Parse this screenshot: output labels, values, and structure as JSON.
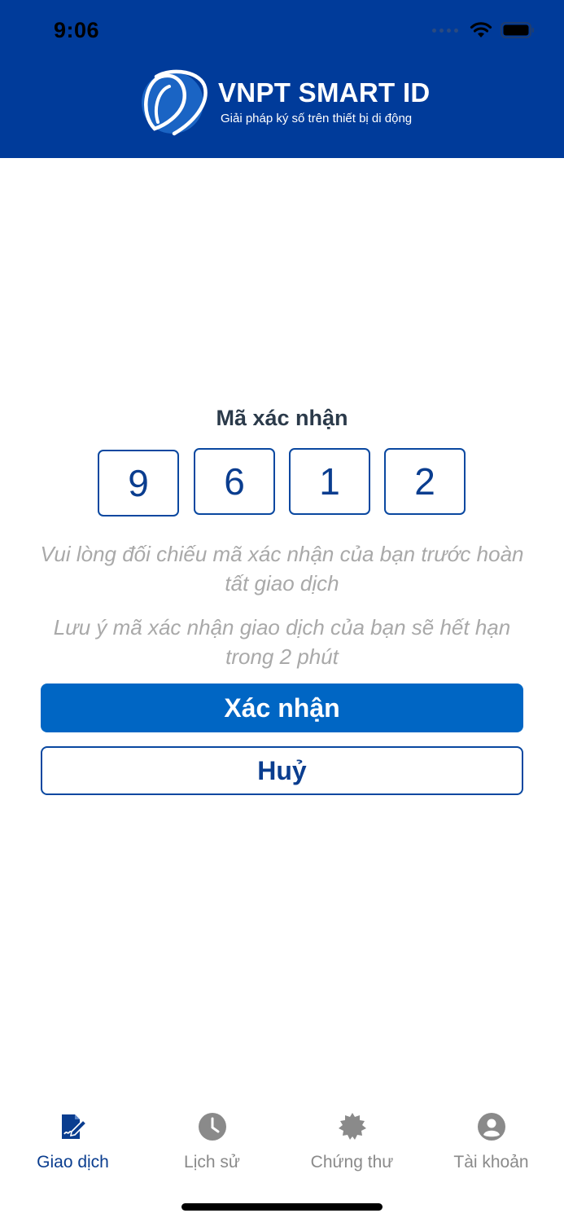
{
  "status_bar": {
    "time": "9:06"
  },
  "brand": {
    "title": "VNPT SMART ID",
    "subtitle": "Giải pháp ký số trên thiết bị di động"
  },
  "verification": {
    "title": "Mã xác nhận",
    "digits": [
      "9",
      "6",
      "1",
      "2"
    ],
    "note1": "Vui lòng đối chiếu mã xác nhận của bạn trước hoàn tất giao dịch",
    "note2": "Lưu ý mã xác nhận giao dịch của bạn sẽ hết hạn trong 2 phút"
  },
  "buttons": {
    "confirm": "Xác nhận",
    "cancel": "Huỷ"
  },
  "tabbar": {
    "items": [
      {
        "label": "Giao dịch",
        "icon": "sign-document-icon",
        "active": true
      },
      {
        "label": "Lịch sử",
        "icon": "clock-icon",
        "active": false
      },
      {
        "label": "Chứng thư",
        "icon": "certificate-badge-icon",
        "active": false
      },
      {
        "label": "Tài khoản",
        "icon": "account-icon",
        "active": false
      }
    ]
  },
  "colors": {
    "header": "#003b9a",
    "primary": "#0066c4",
    "active_tab": "#0a3d8f",
    "inactive_tab": "#8a8a8a"
  }
}
